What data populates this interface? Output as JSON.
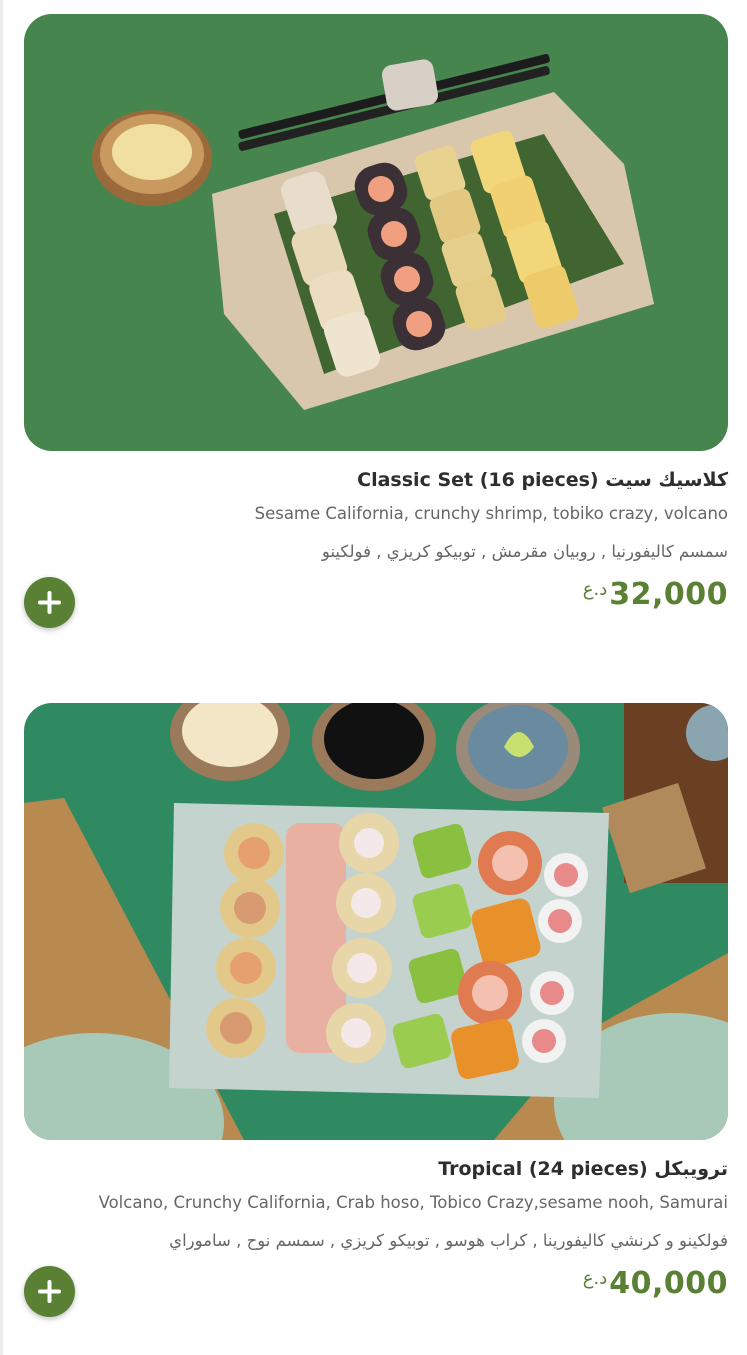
{
  "items": [
    {
      "title": "Classic Set (16 pieces) كلاسيك سيت",
      "description_en": "Sesame California, crunchy shrimp, tobiko crazy, volcano",
      "description_ar": "سمسم كاليفورنيا , روبيان مقرمش , توبيكو كريزي , فولكينو",
      "price": "32,000",
      "currency": "د.ع",
      "add_icon": "plus-icon",
      "image": "classic-set-sushi-photo"
    },
    {
      "title": "Tropical (24 pieces) ترويبكل",
      "description_en": "Volcano, Crunchy California, Crab hoso, Tobico Crazy,sesame nooh, Samurai",
      "description_ar": "فولكينو و كرنشي كاليفورينا , كراب هوسو , توبيكو كريزي , سمسم نوح , ساموراي",
      "price": "40,000",
      "currency": "د.ع",
      "add_icon": "plus-icon",
      "image": "tropical-set-sushi-photo"
    }
  ],
  "colors": {
    "accent": "#5a8034",
    "photo_background_1": "#4c8a52",
    "photo_background_2": "#2f8a62"
  }
}
